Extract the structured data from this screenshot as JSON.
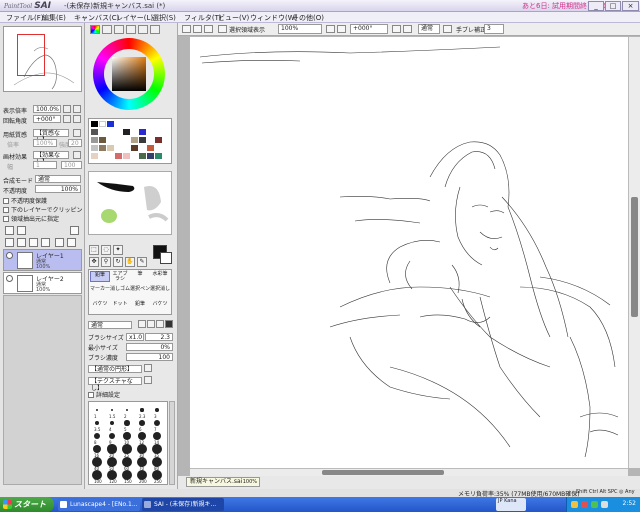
{
  "window": {
    "logo_small": "PaintTool",
    "logo_big": "SAI",
    "document_title": "-(未保存)新規キャンバス.sai (*)",
    "trial_text": "あと6日: 試用期間終了まで"
  },
  "menu": [
    "ファイル(F)",
    "編集(E)",
    "キャンバス(C)",
    "レイヤー(L)",
    "選択(S)",
    "フィルタ(T)",
    "ビュー(V)",
    "ウィンドウ(W)",
    "その他(O)"
  ],
  "navigator": {
    "zoom_label": "表示倍率",
    "zoom_value": "100.0%",
    "rotate_label": "回転角度",
    "rotate_value": "+000°"
  },
  "layer_props": {
    "paper_texture_label": "用紙質感",
    "paper_texture_value": "【質感なし】",
    "scale_label": "倍率",
    "scale_value": "100%",
    "strength_label": "強度",
    "strength_value": "20",
    "effect_label": "画材効果",
    "effect_value": "【効果なし】",
    "width_label": "幅",
    "width_value": "1",
    "strength2_value": "100",
    "blend_mode_label": "合成モード",
    "blend_mode_value": "通常",
    "opacity_label": "不透明度",
    "opacity_value": "100%",
    "protect_alpha": "不透明度保護",
    "clip_lower": "下のレイヤーでクリッピング",
    "selection_source": "領域抽出元に指定"
  },
  "layers": [
    {
      "name": "レイヤー1",
      "mode": "通常",
      "opacity": "100%",
      "selected": true
    },
    {
      "name": "レイヤー2",
      "mode": "通常",
      "opacity": "100%",
      "selected": false
    }
  ],
  "tools": [
    "鉛筆",
    "エアブラシ",
    "筆",
    "水彩筆",
    "マーカー",
    "消しゴム",
    "選択ペン",
    "選択消し",
    "バケツ",
    "ドット",
    "鉛筆",
    "バケツ"
  ],
  "brush": {
    "mode_value": "通常",
    "size_label": "ブラシサイズ",
    "size_mult": "x1.0",
    "size_value": "2.3",
    "min_size_label": "最小サイズ",
    "min_size_value": "0%",
    "density_label": "ブラシ濃度",
    "density_value": "100",
    "shape_value": "【通常の円形】",
    "texture_value": "【テクスチャなし】",
    "detail_label": "詳細設定",
    "preset_labels": [
      "1",
      "1.5",
      "2",
      "2.3",
      "3",
      "3.5",
      "4",
      "5",
      "6",
      "7",
      "8",
      "9",
      "10",
      "12",
      "14",
      "16",
      "20",
      "25",
      "30",
      "35",
      "40",
      "50",
      "60",
      "70",
      "80",
      "100",
      "120",
      "150",
      "200",
      "250"
    ]
  },
  "canvas_toolbar": {
    "show_selection": "選択領域表示",
    "zoom": "100%",
    "angle": "+000°",
    "blend": "通常",
    "stabilizer_label": "手ブレ補正",
    "stabilizer_value": "3"
  },
  "doc_tab": {
    "name": "新規キャンバス.sai",
    "zoom": "100%"
  },
  "status": {
    "memory": "メモリ負荷率:35% (77MB使用/670MB確保)",
    "keys": "Shift Ctrl Alt SPC ◎ Any"
  },
  "taskbar": {
    "start": "スタート",
    "tasks": [
      "Lunascape4 - [ENo.1...",
      "SAI - (未保存)新規キ..."
    ],
    "lang": "JP Kana",
    "clock": "2:52"
  },
  "colors": {
    "accent_selection": "#b9bdf0",
    "taskbar": "#2456c8",
    "start_button": "#2e8a2c",
    "navigator_rect": "#e03030"
  }
}
